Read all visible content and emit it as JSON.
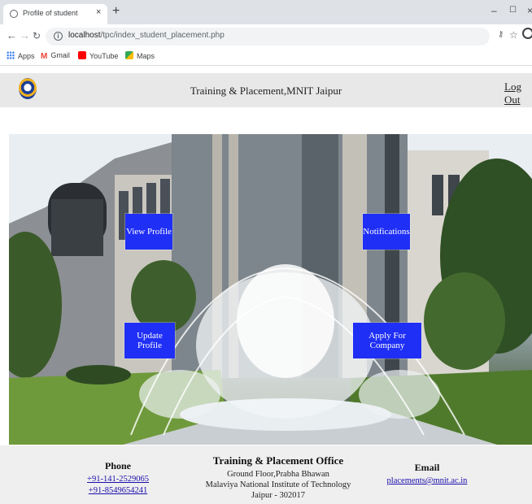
{
  "browser": {
    "tab_title": "Profile of student",
    "tab_close": "×",
    "new_tab": "+",
    "minimize": "–",
    "maximize": "☐",
    "close": "×",
    "url_host": "localhost",
    "url_path": "/tpc/index_student_placement.php",
    "bookmarks": [
      {
        "label": "Apps",
        "color": "#4285f4"
      },
      {
        "label": "Gmail",
        "color": "#ea4335"
      },
      {
        "label": "YouTube",
        "color": "#ff0000"
      },
      {
        "label": "Maps",
        "color": "#34a853"
      }
    ]
  },
  "header": {
    "title": "Training & Placement,MNIT Jaipur",
    "logout": "Log Out"
  },
  "tiles": {
    "view_profile": "View Profile",
    "notifications": "Notifications",
    "update_profile": "Update Profile",
    "apply_company": "Apply For Company"
  },
  "footer": {
    "phone_heading": "Phone",
    "phone_1": "+91-141-2529065",
    "phone_2": "+91-8549654241",
    "office_heading": "Training & Placement Office",
    "office_line_1": "Ground Floor,Prabha Bhawan",
    "office_line_2": "Malaviya National Institute of Technology",
    "office_line_3": "Jaipur - 302017",
    "email_heading": "Email",
    "email": "placements@mnit.ac.in"
  }
}
